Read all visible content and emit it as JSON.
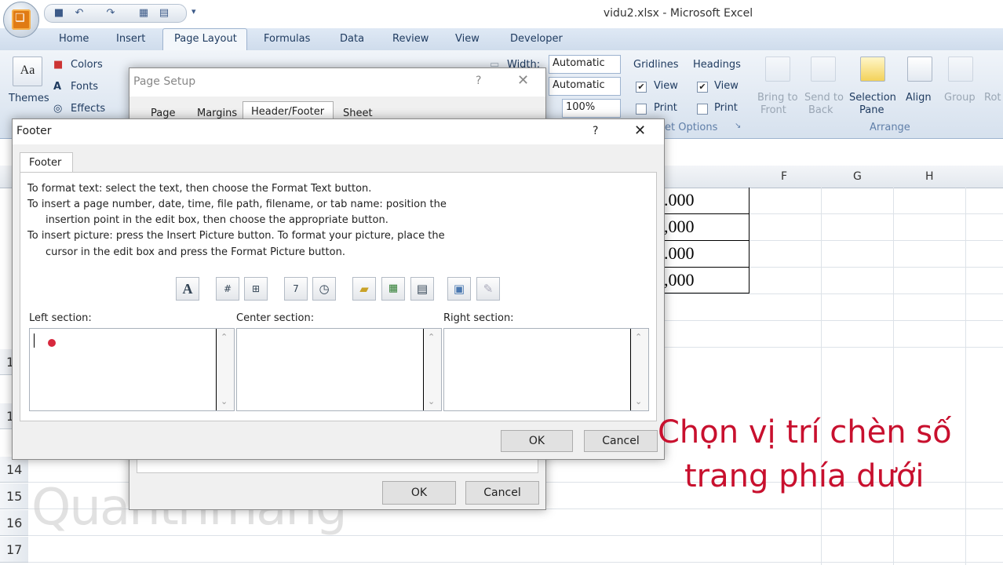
{
  "window": {
    "title": "vidu2.xlsx - Microsoft Excel"
  },
  "qat": {
    "icons": [
      "save-icon",
      "undo-icon",
      "redo-icon",
      "print-preview-icon",
      "print-icon",
      "customize-icon"
    ]
  },
  "tabs": [
    "Home",
    "Insert",
    "Page Layout",
    "Formulas",
    "Data",
    "Review",
    "View",
    "Developer"
  ],
  "active_tab": "Page Layout",
  "ribbon": {
    "themes": {
      "label": "Themes",
      "colors": "Colors",
      "fonts": "Fonts",
      "effects": "Effects"
    },
    "scale": {
      "width_label": "Width:",
      "width_value": "Automatic",
      "height_value": "Automatic",
      "scale_value": "100%"
    },
    "sheet_options": {
      "gridlines": "Gridlines",
      "headings": "Headings",
      "view": "View",
      "print": "Print",
      "group_label": "et Options"
    },
    "arrange": {
      "bring_to_front_1": "Bring to",
      "bring_to_front_2": "Front",
      "send_to_back_1": "Send to",
      "send_to_back_2": "Back",
      "selection_pane_1": "Selection",
      "selection_pane_2": "Pane",
      "align": "Align",
      "group": "Group",
      "rotate": "Rot",
      "group_label": "Arrange"
    }
  },
  "columns": [
    "F",
    "G",
    "H"
  ],
  "rows": [
    "1",
    "1",
    "14",
    "15",
    "16",
    "17"
  ],
  "cells": [
    ".000",
    ",000",
    ".000",
    ",000"
  ],
  "page_setup": {
    "title": "Page Setup",
    "help": "?",
    "tabs": [
      "Page",
      "Margins",
      "Header/Footer",
      "Sheet"
    ],
    "ok": "OK",
    "cancel": "Cancel"
  },
  "footer_dialog": {
    "title": "Footer",
    "help": "?",
    "tab": "Footer",
    "instructions": [
      "To format text:  select the text, then choose the Format Text button.",
      "To insert a page number, date, time, file path, filename, or tab name:  position the",
      "insertion point in the edit box, then choose the appropriate button.",
      "To insert picture: press the Insert Picture button.  To format your picture, place the",
      "cursor in the edit box and press the Format Picture button."
    ],
    "toolbar_icons": [
      "format-text-icon",
      "page-number-icon",
      "number-of-pages-icon",
      "date-icon",
      "time-icon",
      "file-path-icon",
      "filename-icon",
      "sheet-name-icon",
      "insert-picture-icon",
      "format-picture-icon"
    ],
    "left_label": "Left section:",
    "center_label": "Center section:",
    "right_label": "Right section:",
    "left_value": "",
    "center_value": "",
    "right_value": "",
    "ok": "OK",
    "cancel": "Cancel"
  },
  "caption": {
    "line1": "Chọn vị trí chèn số",
    "line2": "trang phía dưới"
  },
  "watermark": "Quantrimang",
  "colors": {
    "caption": "#c8102e",
    "ribbon_text": "#1e3a5f"
  }
}
